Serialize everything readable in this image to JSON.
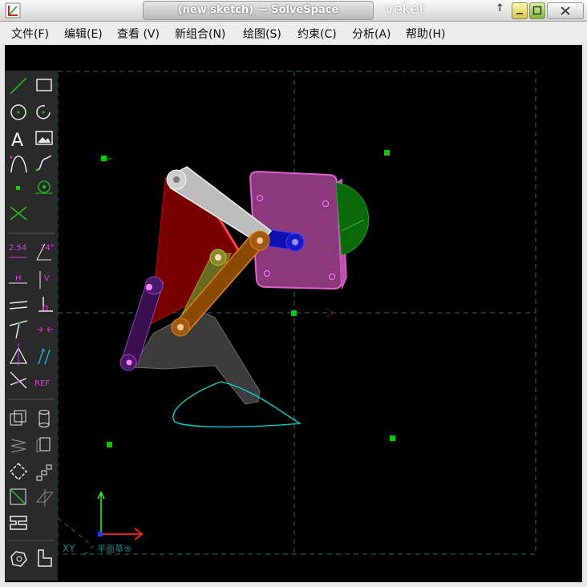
{
  "window": {
    "title": "(new sketch) — SolveSpace",
    "host": "veket",
    "up_arrow": "↑"
  },
  "menu": [
    {
      "label": "文件(F)"
    },
    {
      "label": "编辑(E)"
    },
    {
      "label": "查看 (V)"
    },
    {
      "label": "新组合(N)"
    },
    {
      "label": "绘图(S)"
    },
    {
      "label": "约束(C)"
    },
    {
      "label": "分析(A)"
    },
    {
      "label": "帮助(H)"
    }
  ],
  "toolbar": {
    "text_icon": "A",
    "distance_label": "2.54",
    "angle_label": "74°",
    "horizontal_label": "H",
    "vertical_label": "V",
    "reference_label": "REF"
  },
  "canvas": {
    "axis_label": "XY",
    "workplane_label": "平面草®",
    "colors": {
      "background": "#000000",
      "grid": "#1f6f6f",
      "point": "#00cc00",
      "curve": "#00d8d8",
      "x_axis": "#ff2020",
      "y_axis": "#20ff20",
      "toolbar": "#2a2a2a"
    }
  }
}
